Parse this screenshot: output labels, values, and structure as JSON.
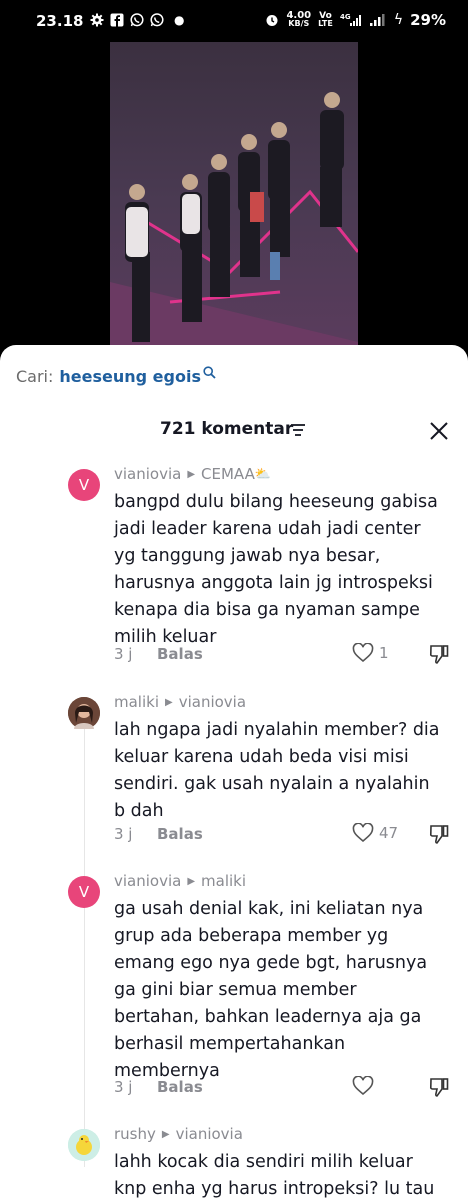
{
  "status_bar": {
    "time": "23.18",
    "net_speed_top": "4.00",
    "net_speed_unit": "KB/S",
    "volte_top": "Vo",
    "volte_bottom": "LTE",
    "net_type": "4G",
    "battery": "29%"
  },
  "sheet": {
    "search_prefix": "Cari:",
    "search_query": "heeseung egois",
    "comment_count": "721 komentar"
  },
  "colors": {
    "accent_link": "#1f5f9e",
    "avatar_v": "#e8457a"
  },
  "comments": [
    {
      "user": "vianiovia",
      "reply_to": "CEMAA",
      "reply_to_emoji": "⛅",
      "avatar_letter": "V",
      "text": "bangpd dulu bilang heeseung gabisa jadi leader karena udah jadi center yg tanggung jawab nya besar, harusnya anggota lain jg introspeksi kenapa dia bisa ga nyaman sampe milih keluar",
      "time": "3 j",
      "reply_label": "Balas",
      "likes": "1"
    },
    {
      "user": "maliki",
      "reply_to": "vianiovia",
      "avatar_letter": "",
      "text": "lah ngapa jadi nyalahin member? dia keluar karena udah beda visi misi sendiri. gak usah nyalain a nyalahin b dah",
      "time": "3 j",
      "reply_label": "Balas",
      "likes": "47"
    },
    {
      "user": "vianiovia",
      "reply_to": "maliki",
      "avatar_letter": "V",
      "text": "ga usah denial kak, ini keliatan nya grup ada beberapa member yg emang ego nya gede bgt, harusnya ga gini biar semua member bertahan, bahkan leadernya aja ga berhasil mempertahankan membernya",
      "time": "3 j",
      "reply_label": "Balas",
      "likes": ""
    },
    {
      "user": "rushy",
      "reply_to": "vianiovia",
      "avatar_letter": "",
      "text": "lahh kocak dia sendiri milih keluar knp enha yg harus intropeksi? lu tau",
      "time": "",
      "reply_label": "",
      "likes": ""
    }
  ]
}
